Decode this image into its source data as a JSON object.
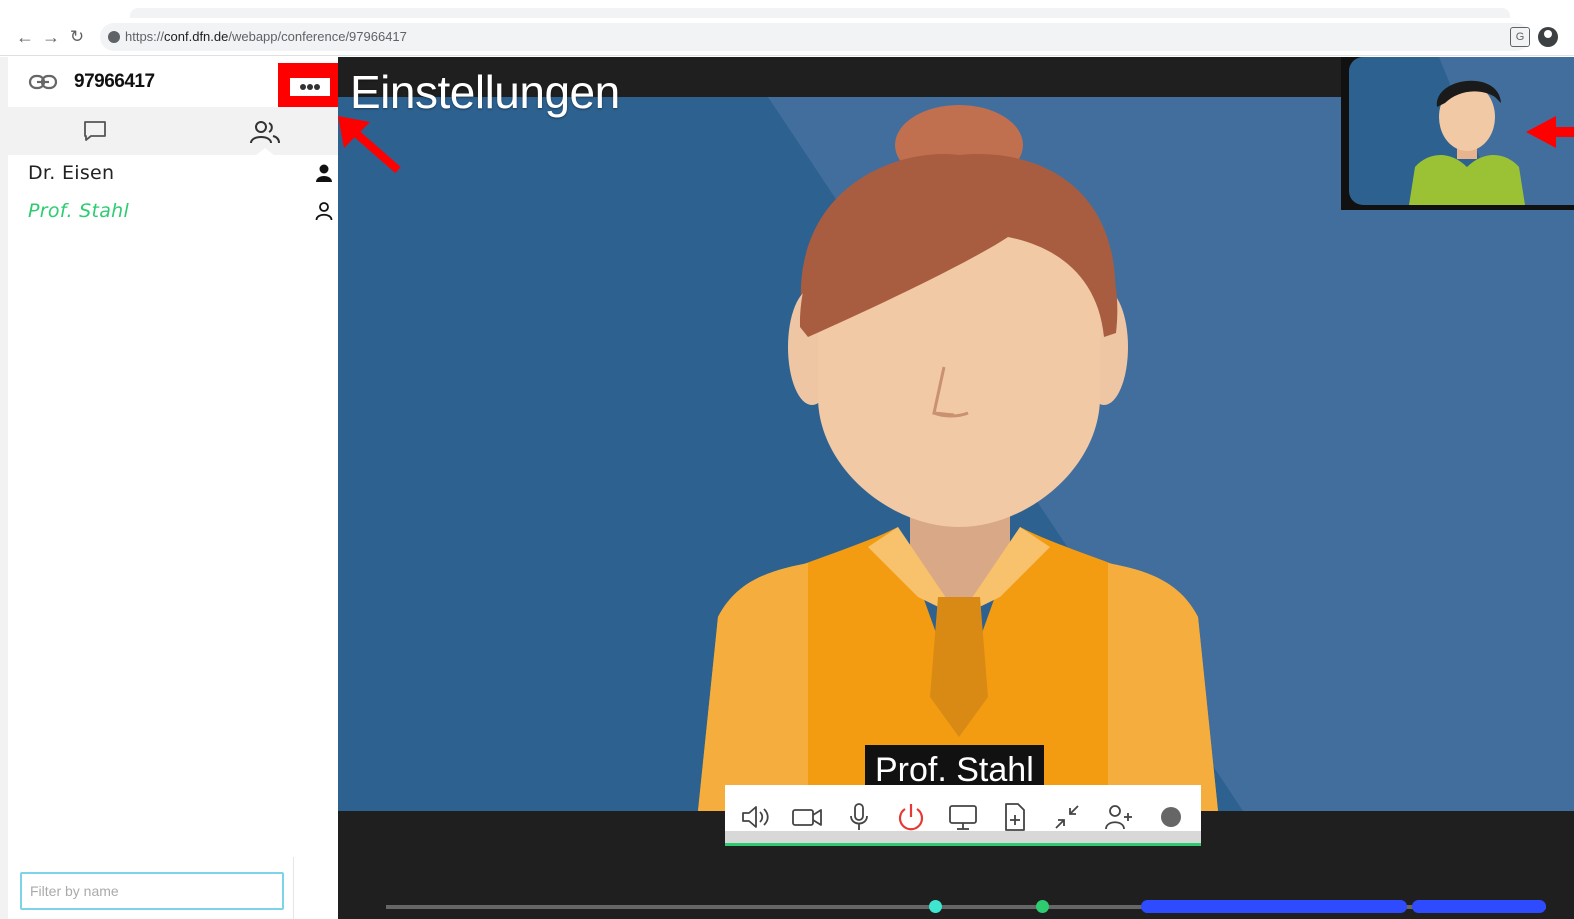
{
  "browser": {
    "url_prefix": "https://",
    "url_host": "conf.dfn.de",
    "url_path": "/webapp/conference/97966417",
    "back_icon": "arrow-left-icon",
    "forward_icon": "arrow-right-icon",
    "reload_icon": "reload-icon"
  },
  "sidebar": {
    "conference_id": "97966417",
    "link_icon": "link-icon",
    "more_icon": "more-options-icon",
    "tabs": [
      {
        "id": "chat",
        "icon": "chat-icon",
        "selected": false
      },
      {
        "id": "participants",
        "icon": "participants-icon",
        "selected": true
      }
    ],
    "participants": [
      {
        "name": "Dr. Eisen",
        "active": false,
        "role_icon": "person-filled-icon"
      },
      {
        "name": "Prof. Stahl",
        "active": true,
        "role_icon": "person-outline-icon"
      }
    ],
    "filter": {
      "placeholder": "Filter by name",
      "value": ""
    }
  },
  "stage": {
    "overlay_title": "Einstellungen",
    "speaker_name": "Prof. Stahl",
    "controls": [
      {
        "id": "volume",
        "icon": "volume-icon"
      },
      {
        "id": "camera",
        "icon": "camera-icon"
      },
      {
        "id": "microphone",
        "icon": "microphone-icon"
      },
      {
        "id": "hangup",
        "icon": "power-icon"
      },
      {
        "id": "screenshare",
        "icon": "monitor-icon"
      },
      {
        "id": "add-document",
        "icon": "document-add-icon"
      },
      {
        "id": "minimize",
        "icon": "minimize-icon"
      },
      {
        "id": "add-participant",
        "icon": "user-add-icon"
      },
      {
        "id": "record",
        "icon": "record-icon"
      }
    ]
  },
  "colors": {
    "accent_green": "#2ecc71",
    "hangup_red": "#e53935",
    "highlight_red": "#ff0000",
    "video_blue": "#2d6190",
    "timeline_blue": "#2e4bff"
  }
}
